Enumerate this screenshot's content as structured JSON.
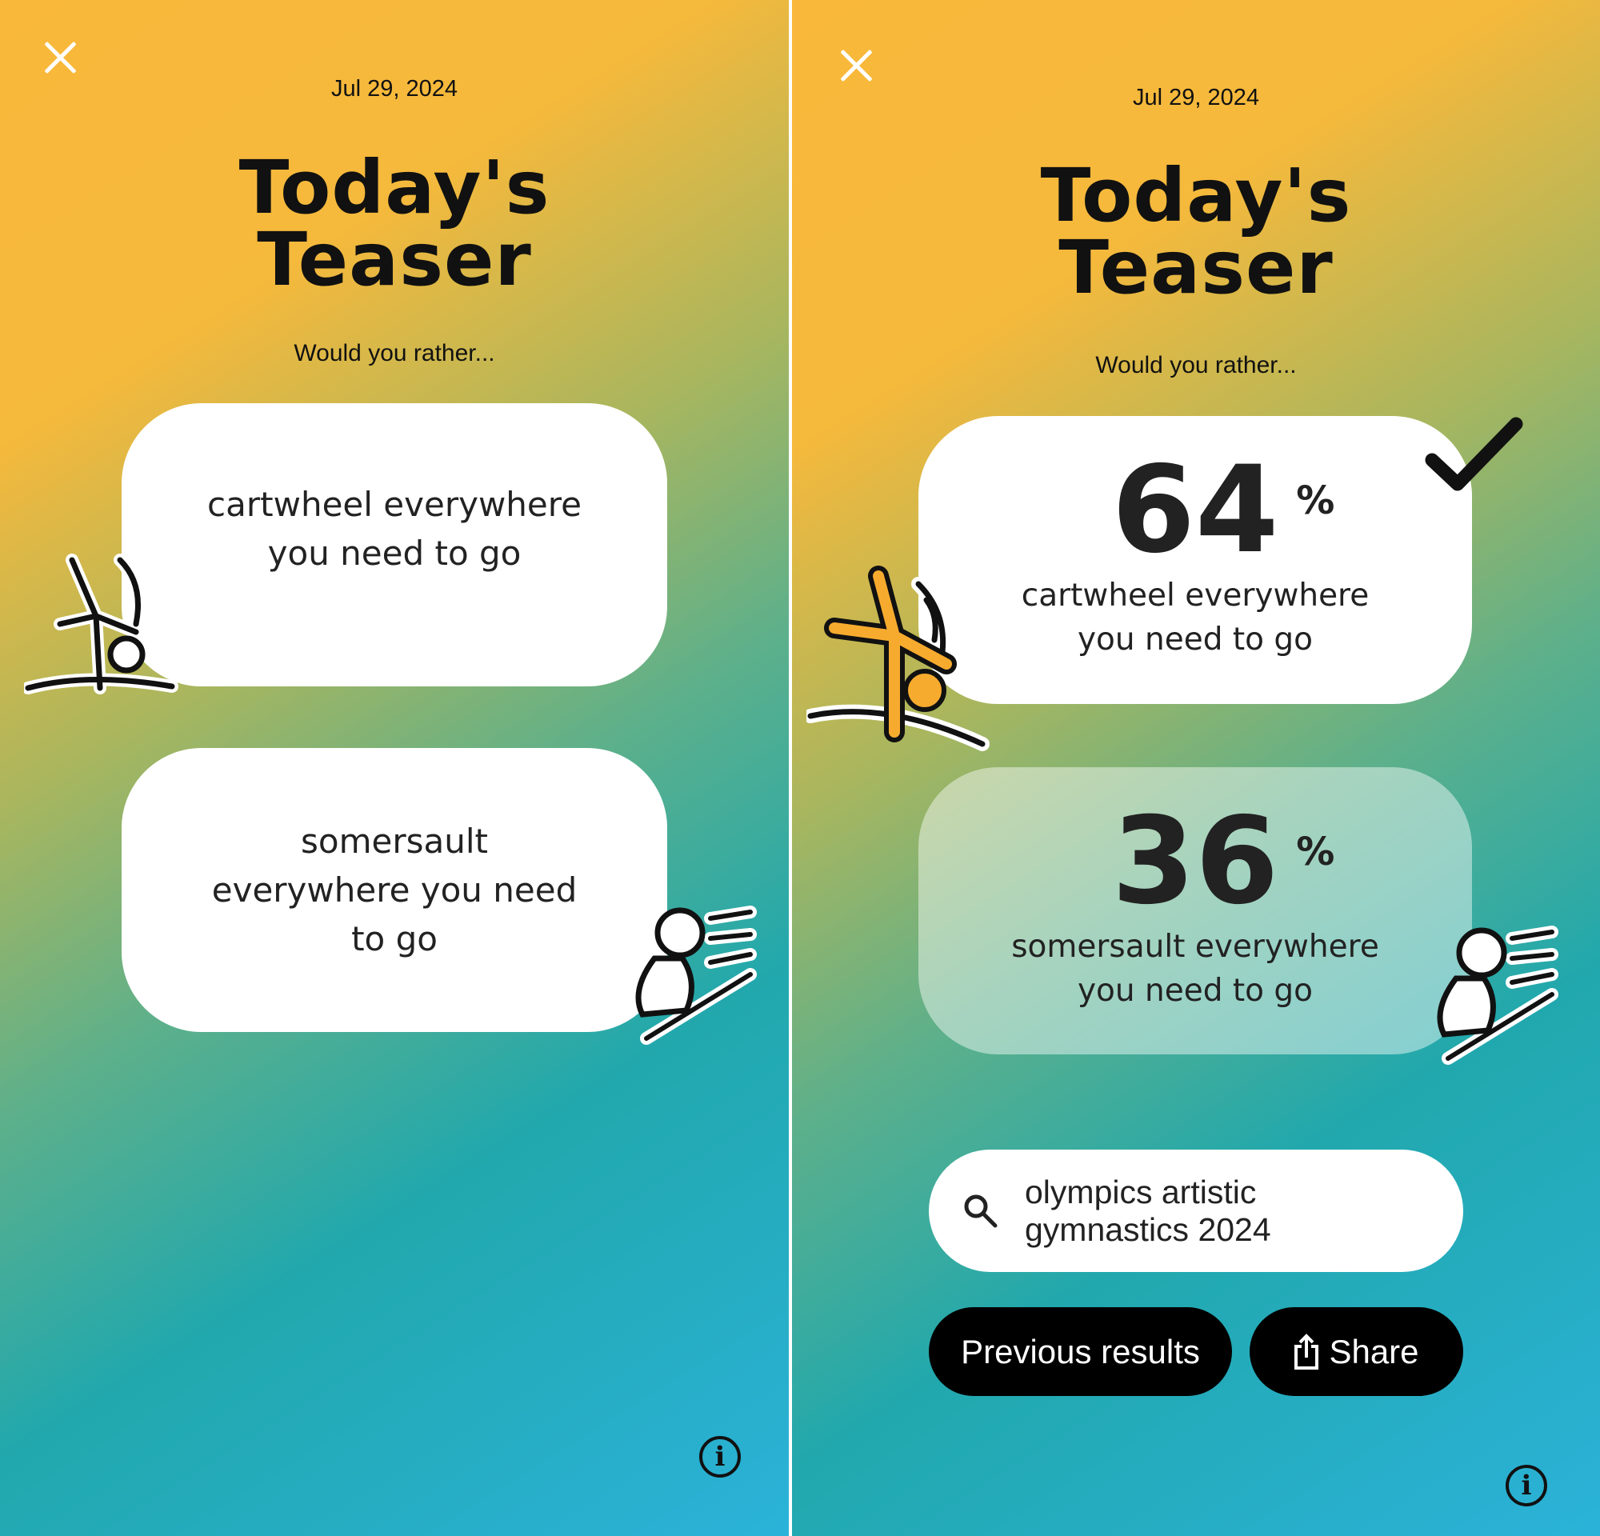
{
  "left": {
    "date": "Jul 29, 2024",
    "title_line1": "Today's",
    "title_line2": "Teaser",
    "subtitle": "Would you rather...",
    "option1": {
      "line1": "cartwheel everywhere",
      "line2": "you need to go"
    },
    "option2": {
      "line1": "somersault",
      "line2": "everywhere you need",
      "line3": "to go"
    }
  },
  "right": {
    "date": "Jul 29, 2024",
    "title_line1": "Today's",
    "title_line2": "Teaser",
    "subtitle": "Would you rather...",
    "option1": {
      "percent": "64",
      "percent_sign": "%",
      "line1": "cartwheel everywhere",
      "line2": "you need to go",
      "selected": true
    },
    "option2": {
      "percent": "36",
      "percent_sign": "%",
      "line1": "somersault everywhere",
      "line2": "you need to go",
      "selected": false
    },
    "search": {
      "line1": "olympics artistic",
      "line2": "gymnastics 2024"
    },
    "previous_results_label": "Previous results",
    "share_label": "Share"
  },
  "icons": {
    "close": "close-icon",
    "info": "info-icon",
    "search": "search-icon",
    "share": "share-icon",
    "check": "checkmark-icon"
  },
  "colors": {
    "gradient_top": "#f9b83a",
    "gradient_mid": "#21a8ad",
    "gradient_bottom": "#2bb2d9",
    "figure_accent": "#f7ab2e"
  }
}
